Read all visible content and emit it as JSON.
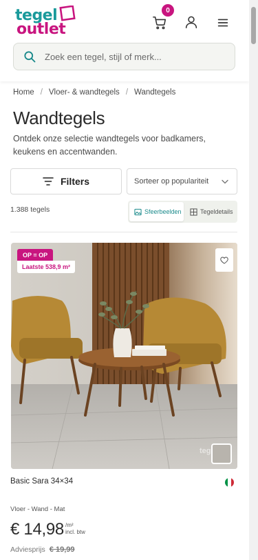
{
  "header": {
    "logo_line1": "tegel",
    "logo_line2": "outlet",
    "cart_count": "0",
    "icons": [
      "cart-icon",
      "account-icon",
      "menu-icon"
    ]
  },
  "search": {
    "placeholder": "Zoek een tegel, stijl of merk..."
  },
  "breadcrumb": [
    "Home",
    "Vloer- & wandtegels",
    "Wandtegels"
  ],
  "page": {
    "title": "Wandtegels",
    "description": "Ontdek onze selectie wandtegels voor badkamers, keukens en accentwanden."
  },
  "toolbar": {
    "filters_label": "Filters",
    "sort_selected": "Sorteer op populariteit",
    "count": "1.388 tegels",
    "view_options": [
      "Sfeerbeelden",
      "Tegeldetails"
    ],
    "active_view": "Sfeerbeelden"
  },
  "product": {
    "badge_primary": "OP = OP",
    "badge_secondary": "Laatste 538,9 m²",
    "watermark": "tegel",
    "name": "Basic Sara 34×34",
    "meta": "Vloer - Wand - Mat",
    "price": "€ 14,98",
    "price_unit_line1": "/m²",
    "price_unit_line2": "incl. btw",
    "advice_label": "Adviesprijs",
    "advice_price": "€ 19,99"
  },
  "colors": {
    "brand_teal": "#1a9a9b",
    "brand_magenta": "#c8157f",
    "flag": [
      "#009246",
      "#ffffff",
      "#ce2b37"
    ]
  }
}
